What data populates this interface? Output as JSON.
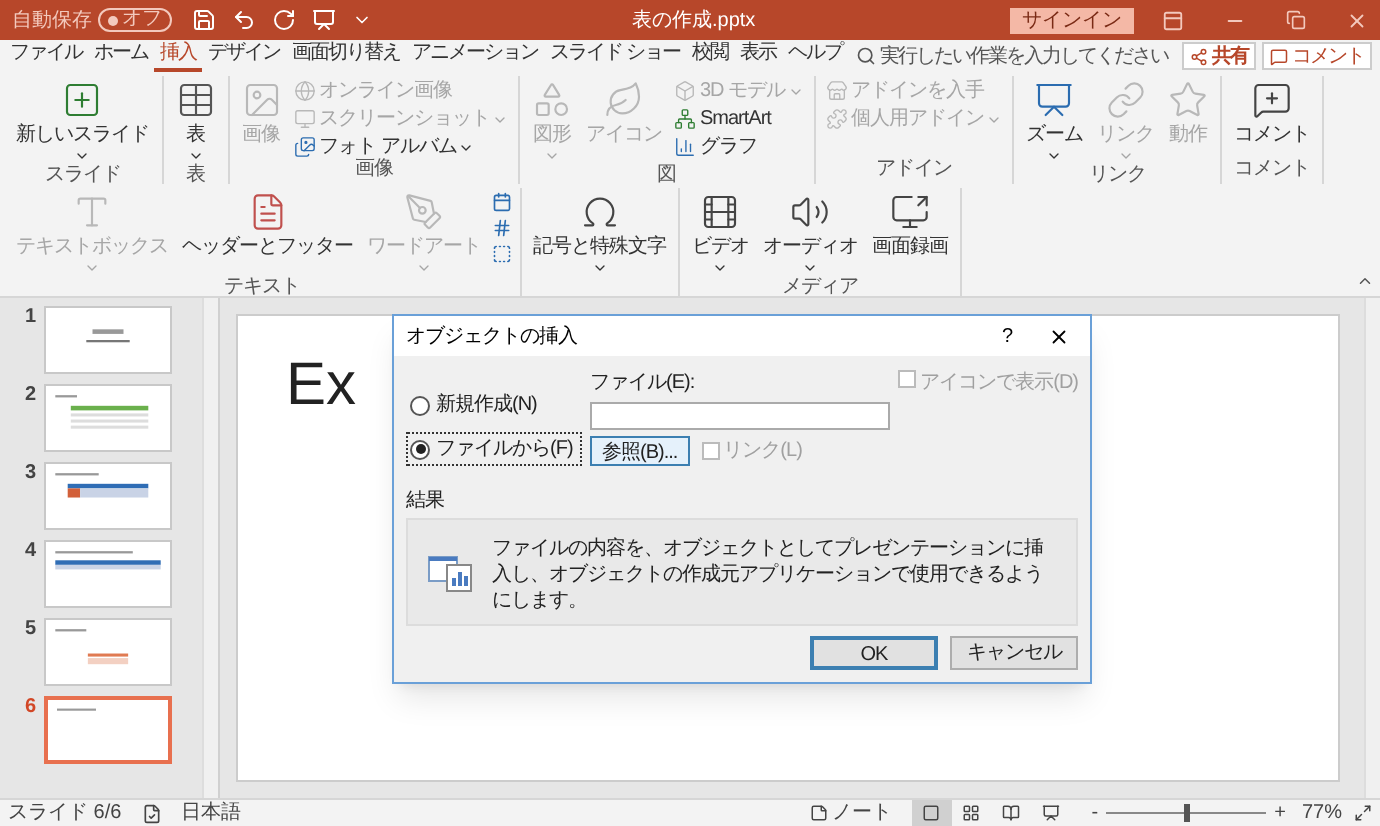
{
  "title_bar": {
    "autosave_label": "自動保存",
    "autosave_toggle": "オフ",
    "autosave_on": false,
    "document_title": "表の作成.pptx",
    "signin": "サインイン"
  },
  "tabs": [
    {
      "label": "ファイル",
      "selected": false
    },
    {
      "label": "ホーム",
      "selected": false
    },
    {
      "label": "挿入",
      "selected": true
    },
    {
      "label": "デザイン",
      "selected": false
    },
    {
      "label": "画面切り替え",
      "selected": false
    },
    {
      "label": "アニメーション",
      "selected": false
    },
    {
      "label": "スライド ショー",
      "selected": false
    },
    {
      "label": "校閲",
      "selected": false
    },
    {
      "label": "表示",
      "selected": false
    },
    {
      "label": "ヘルプ",
      "selected": false
    }
  ],
  "search": {
    "placeholder": "実行したい作業を入力してください"
  },
  "share_button": "共有",
  "comment_button": "コメント",
  "ribbon_groups": [
    {
      "label": "スライド",
      "items": [
        {
          "kind": "large",
          "label": "新しいスライド",
          "dropdown": true,
          "disabled": false
        }
      ]
    },
    {
      "label": "表",
      "items": [
        {
          "kind": "large",
          "label": "表",
          "dropdown": true,
          "disabled": false
        }
      ]
    },
    {
      "label": "画像",
      "items": [
        {
          "kind": "large",
          "label": "画像",
          "dropdown": false,
          "disabled": true
        },
        {
          "kind": "small",
          "label": "オンライン画像",
          "dropdown": false,
          "disabled": true
        },
        {
          "kind": "small",
          "label": "スクリーンショット",
          "dropdown": true,
          "disabled": true
        },
        {
          "kind": "small",
          "label": "フォト アルバム",
          "dropdown": true,
          "disabled": false
        }
      ]
    },
    {
      "label": "図",
      "items": [
        {
          "kind": "large",
          "label": "図形",
          "dropdown": true,
          "disabled": true
        },
        {
          "kind": "large",
          "label": "アイコン",
          "dropdown": false,
          "disabled": true
        },
        {
          "kind": "small",
          "label": "3D モデル",
          "dropdown": true,
          "disabled": true
        },
        {
          "kind": "small",
          "label": "SmartArt",
          "dropdown": false,
          "disabled": false
        },
        {
          "kind": "small",
          "label": "グラフ",
          "dropdown": false,
          "disabled": false
        }
      ]
    },
    {
      "label": "アドイン",
      "items": [
        {
          "kind": "small",
          "label": "アドインを入手",
          "dropdown": false,
          "disabled": true
        },
        {
          "kind": "small",
          "label": "個人用アドイン",
          "dropdown": true,
          "disabled": true
        }
      ]
    },
    {
      "label": "リンク",
      "items": [
        {
          "kind": "large",
          "label": "ズーム",
          "dropdown": true,
          "disabled": false
        },
        {
          "kind": "large",
          "label": "リンク",
          "dropdown": true,
          "disabled": true
        },
        {
          "kind": "large",
          "label": "動作",
          "dropdown": false,
          "disabled": true
        }
      ]
    },
    {
      "label": "コメント",
      "items": [
        {
          "kind": "large",
          "label": "コメント",
          "dropdown": false,
          "disabled": false
        }
      ]
    },
    {
      "label": "テキスト",
      "items": [
        {
          "kind": "large",
          "label": "テキストボックス",
          "dropdown": true,
          "disabled": true
        },
        {
          "kind": "large",
          "label": "ヘッダーとフッター",
          "dropdown": false,
          "disabled": false
        },
        {
          "kind": "large",
          "label": "ワードアート",
          "dropdown": true,
          "disabled": true
        },
        {
          "kind": "icons"
        }
      ]
    },
    {
      "items": [
        {
          "kind": "large",
          "label": "記号と特殊文字",
          "dropdown": true,
          "disabled": false
        }
      ]
    },
    {
      "label": "メディア",
      "items": [
        {
          "kind": "large",
          "label": "ビデオ",
          "dropdown": true,
          "disabled": false
        },
        {
          "kind": "large",
          "label": "オーディオ",
          "dropdown": true,
          "disabled": false
        },
        {
          "kind": "large",
          "label": "画面録画",
          "dropdown": false,
          "disabled": false
        }
      ]
    }
  ],
  "slides": [
    {
      "number": "1",
      "kind": "title",
      "selected": false
    },
    {
      "number": "2",
      "kind": "green-table",
      "selected": false
    },
    {
      "number": "3",
      "kind": "blue-table",
      "selected": false
    },
    {
      "number": "4",
      "kind": "wide-table",
      "selected": false
    },
    {
      "number": "5",
      "kind": "orange-table",
      "selected": false
    },
    {
      "number": "6",
      "kind": "heading",
      "selected": true
    }
  ],
  "slide": {
    "title": "Ex"
  },
  "dialog": {
    "title": "オブジェクトの挿入",
    "help": "?",
    "options": [
      {
        "label": "新規作成(N)",
        "selected": false
      },
      {
        "label": "ファイルから(F)",
        "selected": true
      }
    ],
    "file_label": "ファイル(E):",
    "browse_button": "参照(B)...",
    "link_checkbox": {
      "label": "リンク(L)",
      "checked": false,
      "disabled": true
    },
    "icon_checkbox": {
      "label": "アイコンで表示(D)",
      "checked": false,
      "disabled": true
    },
    "result_label": "結果",
    "result_text": "ファイルの内容を、オブジェクトとしてプレゼンテーションに挿入し、オブジェクトの作成元アプリケーションで使用できるようにします。",
    "ok_button": "OK",
    "cancel_button": "キャンセル"
  },
  "status_bar": {
    "slide_indicator": "スライド 6/6",
    "language": "日本語",
    "notes": "ノート",
    "views": [
      {
        "selected": true
      },
      {
        "selected": false
      },
      {
        "selected": false
      },
      {
        "selected": false
      }
    ],
    "zoom_minus": "-",
    "zoom_plus": "+",
    "zoom": {
      "level": 0.5,
      "reading": "77%"
    }
  }
}
